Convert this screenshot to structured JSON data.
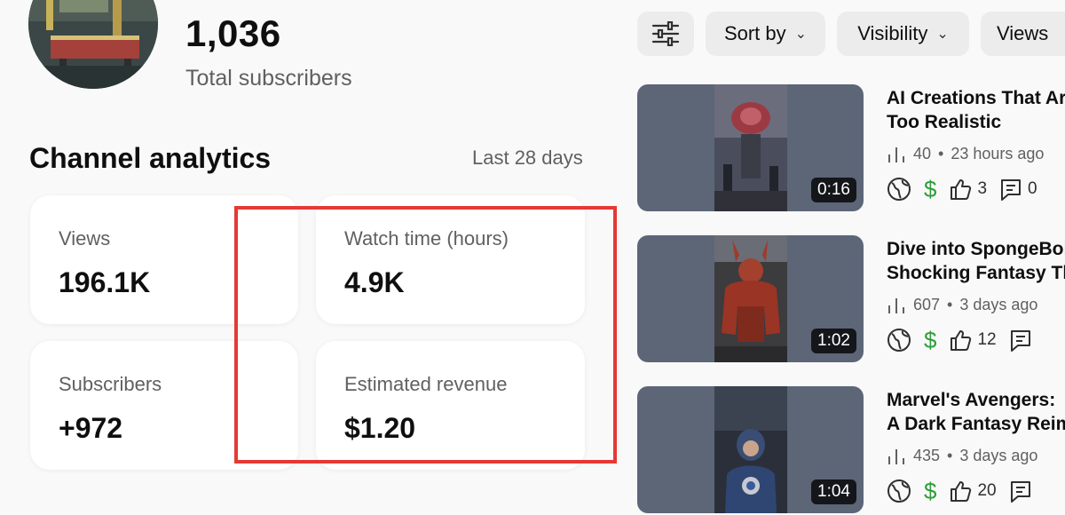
{
  "channel": {
    "subscriber_count": "1,036",
    "subscriber_label": "Total subscribers"
  },
  "analytics": {
    "title": "Channel analytics",
    "period": "Last 28 days",
    "cards": [
      {
        "label": "Views",
        "value": "196.1K"
      },
      {
        "label": "Watch time (hours)",
        "value": "4.9K"
      },
      {
        "label": "Subscribers",
        "value": "+972"
      },
      {
        "label": "Estimated revenue",
        "value": "$1.20"
      }
    ],
    "highlight_color": "#e53935"
  },
  "filters": {
    "tune_icon": "tune-icon",
    "sort_label": "Sort by",
    "visibility_label": "Visibility",
    "views_label": "Views"
  },
  "videos": [
    {
      "title_line1": "AI Creations That Ar",
      "title_line2": "Too Realistic",
      "views": "40",
      "age": "23 hours ago",
      "likes": "3",
      "comments": "0",
      "duration": "0:16"
    },
    {
      "title_line1": "Dive into SpongeBob",
      "title_line2": "Shocking Fantasy Th",
      "views": "607",
      "age": "3 days ago",
      "likes": "12",
      "comments": "",
      "duration": "1:02"
    },
    {
      "title_line1": "Marvel's Avengers:",
      "title_line2": "A Dark Fantasy Reim",
      "views": "435",
      "age": "3 days ago",
      "likes": "20",
      "comments": "",
      "duration": "1:04"
    }
  ],
  "colors": {
    "revenue_green": "#2e9d3a",
    "text_secondary": "#606060"
  }
}
